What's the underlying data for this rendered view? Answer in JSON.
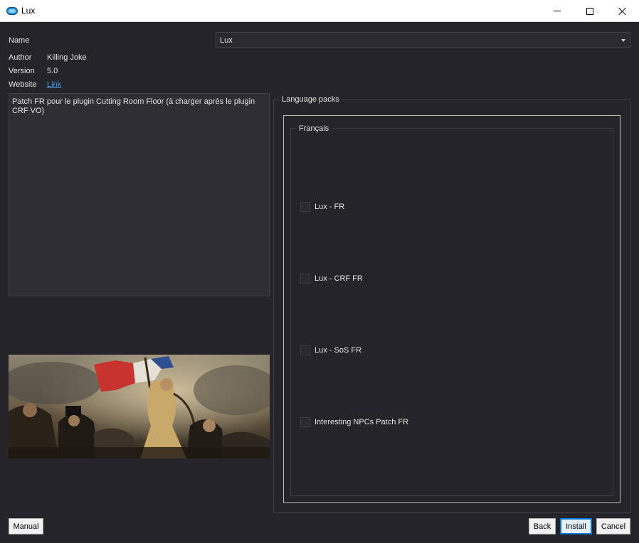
{
  "window": {
    "title": "Lux",
    "icon": "app-cloud-icon"
  },
  "info": {
    "name_label": "Name",
    "name_value": "Lux",
    "author_label": "Author",
    "author_value": "Killing Joke",
    "version_label": "Version",
    "version_value": "5.0",
    "website_label": "Website",
    "website_link": "Link"
  },
  "description": "Patch FR pour le plugin Cutting Room Floor (à charger après le plugin CRF VO)",
  "language_packs": {
    "title": "Language packs",
    "group_title": "Français",
    "options": [
      {
        "label": "Lux - FR",
        "checked": false
      },
      {
        "label": "Lux - CRF FR",
        "checked": false
      },
      {
        "label": "Lux - SoS FR",
        "checked": false
      },
      {
        "label": "Interesting NPCs Patch FR",
        "checked": false
      }
    ]
  },
  "buttons": {
    "manual": "Manual",
    "back": "Back",
    "install": "Install",
    "cancel": "Cancel"
  },
  "colors": {
    "background": "#252529",
    "link": "#3f9be8",
    "accent": "#0078d7"
  }
}
